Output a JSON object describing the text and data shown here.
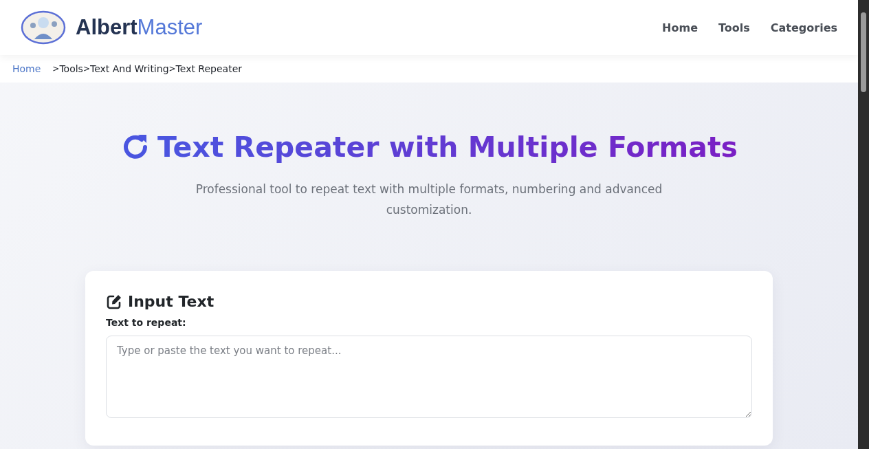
{
  "header": {
    "logo": {
      "part_1": "Albert",
      "part_2": "Master"
    },
    "nav": [
      "Home",
      "Tools",
      "Categories"
    ]
  },
  "breadcrumb": [
    {
      "label": "Home"
    },
    {
      "label": "Tools",
      "separator": ">"
    },
    {
      "label": "Text And Writing",
      "separator": ">"
    },
    {
      "label": "Text Repeater",
      "separator": ">"
    }
  ],
  "hero": {
    "title": "Text Repeater with Multiple Formats",
    "subtitle": "Professional tool to repeat text with multiple formats, numbering and advanced customization."
  },
  "input_card": {
    "title": "Input Text",
    "label": "Text to repeat:",
    "placeholder": "Type or paste the text you want to repeat..."
  }
}
